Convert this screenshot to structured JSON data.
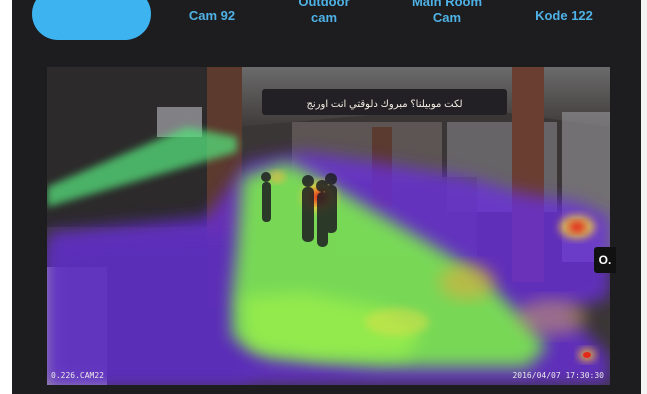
{
  "tabs": [
    {
      "lines": [
        "Cam 92"
      ],
      "active": false
    },
    {
      "lines": [
        "Outdoor",
        "cam"
      ],
      "active": false
    },
    {
      "lines": [
        "Main Room",
        "Cam"
      ],
      "active": false
    },
    {
      "lines": [
        "Kode 122"
      ],
      "active": false
    }
  ],
  "active_tab": {
    "label": ""
  },
  "camera": {
    "id_text": "0.226.CAM22",
    "timestamp": "2016/04/07 17:30:30",
    "edge_label": "O."
  },
  "scene": {
    "banner_text": "لكت موبيلنا؟ مبروك دلوقتي انت اورنج"
  },
  "colors": {
    "accent": "#3db3ef",
    "tab_text": "#4fb2e6",
    "heat_low": "#6a2fe0",
    "heat_mid": "#7cf04a",
    "heat_high": "#e32a1a"
  }
}
